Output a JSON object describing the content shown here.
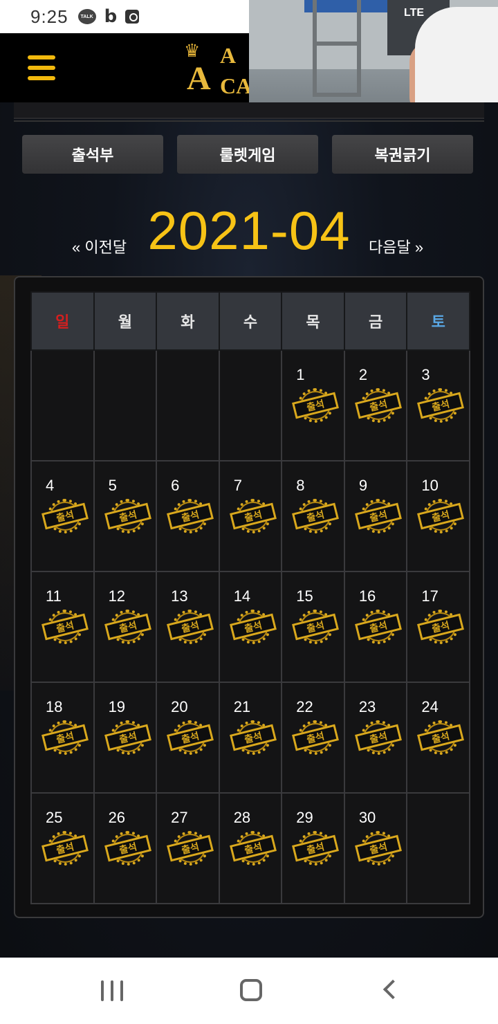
{
  "status_bar": {
    "time": "9:25",
    "talk_icon_text": "TALK",
    "b_icon_text": "b",
    "network": "LTE"
  },
  "header": {
    "logo_top": "A",
    "logo_big_letter": "A",
    "logo_line2": "CA"
  },
  "tabs": [
    {
      "label": "출석부"
    },
    {
      "label": "룰렛게임"
    },
    {
      "label": "복권긁기"
    }
  ],
  "calendar": {
    "prev_label": "« 이전달",
    "month": "2021-04",
    "next_label": "다음달 »",
    "weekdays": [
      "일",
      "월",
      "화",
      "수",
      "목",
      "금",
      "토"
    ],
    "stamp_label": "출석",
    "weeks": [
      [
        "",
        "",
        "",
        "",
        "1",
        "2",
        "3"
      ],
      [
        "4",
        "5",
        "6",
        "7",
        "8",
        "9",
        "10"
      ],
      [
        "11",
        "12",
        "13",
        "14",
        "15",
        "16",
        "17"
      ],
      [
        "18",
        "19",
        "20",
        "21",
        "22",
        "23",
        "24"
      ],
      [
        "25",
        "26",
        "27",
        "28",
        "29",
        "30",
        ""
      ]
    ]
  },
  "colors": {
    "accent": "#f7c316",
    "sunday": "#d41f1f",
    "saturday": "#5aa8e6",
    "stamp": "#d9a81d"
  }
}
